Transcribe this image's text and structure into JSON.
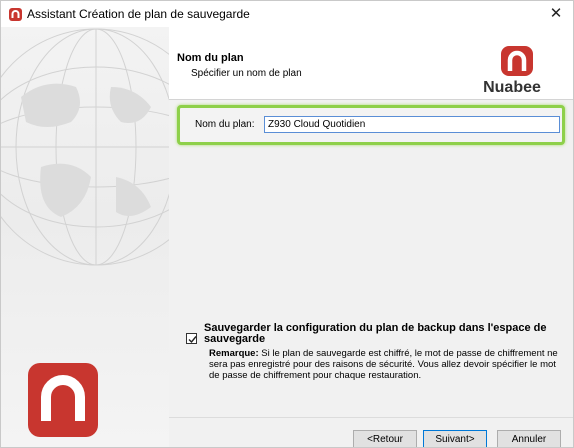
{
  "window": {
    "title": "Assistant Création de plan de sauvegarde",
    "close_icon": "close-icon",
    "app_icon": "nuabee-app-icon"
  },
  "header": {
    "title": "Nom du plan",
    "subtitle": "Spécifier un nom de plan",
    "brand_name": "Nuabee"
  },
  "form": {
    "name_label": "Nom du plan:",
    "name_value": "Z930 Cloud Quotidien"
  },
  "options": {
    "save_config_checked": true,
    "save_config_label": "Sauvegarder la configuration du plan de backup dans l'espace de sauvegarde",
    "remark_title": "Remarque:",
    "remark_text": "Si le plan de sauvegarde est chiffré, le mot de passe de chiffrement ne sera pas enregistré pour des raisons de sécurité. Vous allez devoir spécifier le mot de passe de chiffrement pour chaque restauration."
  },
  "buttons": {
    "back": "<Retour",
    "next": "Suivant>",
    "cancel": "Annuler"
  },
  "colors": {
    "brand_red": "#c8362f",
    "highlight_green": "#8ed04a",
    "focus_blue": "#0078d7"
  }
}
